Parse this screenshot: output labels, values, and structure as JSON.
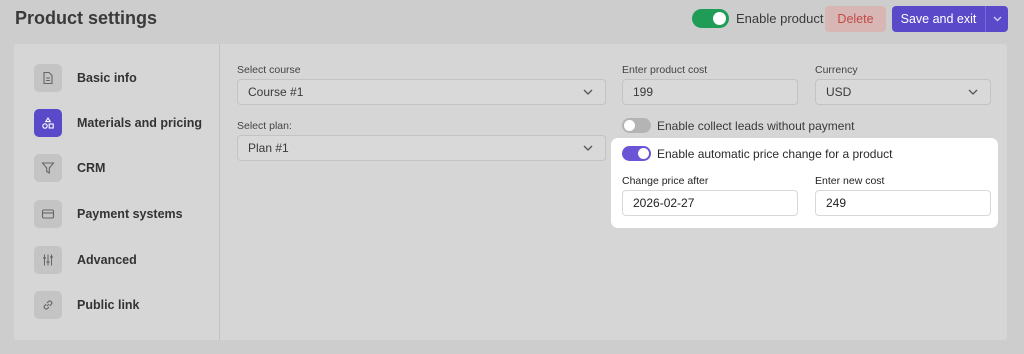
{
  "header": {
    "title": "Product settings",
    "enable_product": {
      "label": "Enable product",
      "enabled": true
    },
    "delete_label": "Delete",
    "save_label": "Save and exit"
  },
  "sidebar": {
    "items": [
      {
        "label": "Basic info",
        "icon": "document-icon",
        "active": false
      },
      {
        "label": "Materials and pricing",
        "icon": "shapes-icon",
        "active": true
      },
      {
        "label": "CRM",
        "icon": "funnel-icon",
        "active": false
      },
      {
        "label": "Payment systems",
        "icon": "credit-card-icon",
        "active": false
      },
      {
        "label": "Advanced",
        "icon": "sliders-icon",
        "active": false
      },
      {
        "label": "Public link",
        "icon": "link-icon",
        "active": false
      }
    ]
  },
  "form": {
    "course": {
      "label": "Select course",
      "value": "Course #1"
    },
    "plan": {
      "label": "Select plan:",
      "value": "Plan #1"
    },
    "cost": {
      "label": "Enter product cost",
      "value": "199"
    },
    "currency": {
      "label": "Currency",
      "value": "USD"
    },
    "collect_leads": {
      "label": "Enable collect leads without payment",
      "enabled": false
    },
    "auto_price": {
      "label": "Enable automatic price change for a product",
      "enabled": true
    },
    "change_after": {
      "label": "Change price after",
      "value": "2026-02-27"
    },
    "new_cost": {
      "label": "Enter new cost",
      "value": "249"
    }
  },
  "colors": {
    "accent": "#5a4ac9",
    "toggle_on_green": "#1f9d57",
    "toggle_on_purple": "#6b54d6",
    "delete_text": "#c24b47"
  }
}
